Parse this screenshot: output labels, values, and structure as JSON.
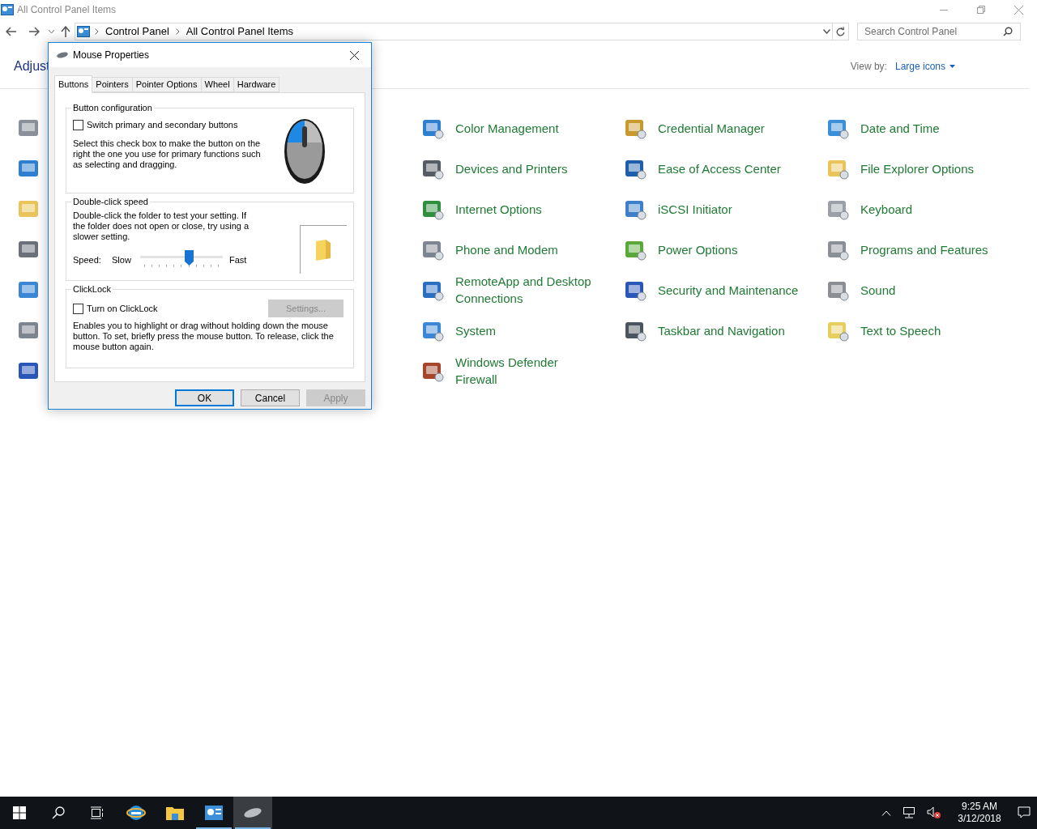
{
  "window": {
    "title": "All Control Panel Items"
  },
  "address": {
    "path": [
      "Control Panel",
      "All Control Panel Items"
    ]
  },
  "search": {
    "placeholder": "Search Control Panel"
  },
  "heading": "Adjust",
  "view_by": {
    "label": "View by:",
    "value": "Large icons"
  },
  "items": [
    {
      "label": "Color Management"
    },
    {
      "label": "Credential Manager"
    },
    {
      "label": "Date and Time"
    },
    {
      "label": "Devices and Printers"
    },
    {
      "label": "Ease of Access Center"
    },
    {
      "label": "File Explorer Options"
    },
    {
      "label": "Internet Options"
    },
    {
      "label": "iSCSI Initiator"
    },
    {
      "label": "Keyboard"
    },
    {
      "label": "Phone and Modem"
    },
    {
      "label": "Power Options"
    },
    {
      "label": "Programs and Features"
    },
    {
      "label": "RemoteApp and Desktop Connections"
    },
    {
      "label": "Security and Maintenance"
    },
    {
      "label": "Sound"
    },
    {
      "label": "System"
    },
    {
      "label": "Taskbar and Navigation"
    },
    {
      "label": "Text to Speech"
    },
    {
      "label": "Windows Defender Firewall"
    }
  ],
  "dialog": {
    "title": "Mouse Properties",
    "tabs": [
      {
        "label": "Buttons",
        "selected": true
      },
      {
        "label": "Pointers",
        "selected": false
      },
      {
        "label": "Pointer Options",
        "selected": false
      },
      {
        "label": "Wheel",
        "selected": false
      },
      {
        "label": "Hardware",
        "selected": false
      }
    ],
    "button_configuration": {
      "title": "Button configuration",
      "checkbox": {
        "label": "Switch primary and secondary buttons",
        "checked": false
      },
      "description": "Select this check box to make the button on the right the one you use for primary functions such as selecting and dragging."
    },
    "double_click_speed": {
      "title": "Double-click speed",
      "description": "Double-click the folder to test your setting. If the folder does not open or close, try using a slower setting.",
      "speed_label": "Speed:",
      "slow": "Slow",
      "fast": "Fast",
      "level": 0.59
    },
    "clicklock": {
      "title": "ClickLock",
      "checkbox": {
        "label": "Turn on ClickLock",
        "checked": false
      },
      "settings_button": {
        "label": "Settings...",
        "disabled": true
      },
      "description": "Enables you to highlight or drag without holding down the mouse button. To set, briefly press the mouse button. To release, click the mouse button again."
    },
    "buttons": [
      {
        "label": "OK",
        "disabled": false,
        "default": true
      },
      {
        "label": "Cancel",
        "disabled": false,
        "default": false
      },
      {
        "label": "Apply",
        "disabled": true,
        "default": false
      }
    ]
  },
  "taskbar": {
    "apps": [
      {
        "kind": "browser",
        "running": false,
        "selected": false
      },
      {
        "kind": "folder",
        "running": false,
        "selected": false
      },
      {
        "kind": "panel",
        "running": true,
        "selected": false
      },
      {
        "kind": "mouse",
        "running": true,
        "selected": true
      }
    ],
    "time": "9:25 AM",
    "date": "3/12/2018"
  }
}
